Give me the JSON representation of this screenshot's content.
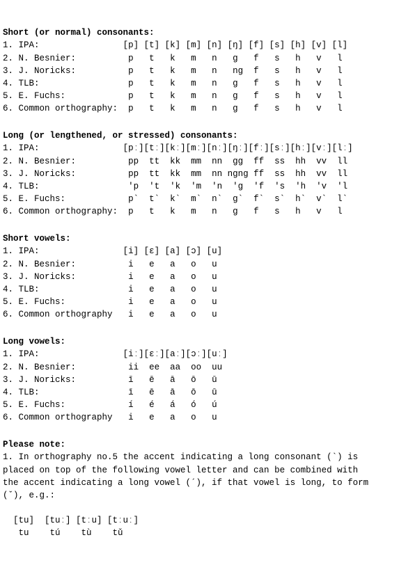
{
  "sections": {
    "short_consonants": {
      "heading": "Short (or normal) consonants:",
      "rows": [
        {
          "num": "1.",
          "label": "IPA:",
          "cells": "[p] [t] [k] [m] [n] [ŋ] [f] [s] [h] [v] [l]"
        },
        {
          "num": "2.",
          "label": "N. Besnier:",
          "cells": " p   t   k   m   n   g   f   s   h   v   l "
        },
        {
          "num": "3.",
          "label": "J. Noricks:",
          "cells": " p   t   k   m   n   ng  f   s   h   v   l "
        },
        {
          "num": "4.",
          "label": "TLB:",
          "cells": " p   t   k   m   n   g   f   s   h   v   l "
        },
        {
          "num": "5.",
          "label": "E. Fuchs:",
          "cells": " p   t   k   m   n   g   f   s   h   v   l "
        },
        {
          "num": "6.",
          "label": "Common orthography:",
          "cells": " p   t   k   m   n   g   f   s   h   v   l "
        }
      ]
    },
    "long_consonants": {
      "heading": "Long (or lengthened, or stressed) consonants:",
      "rows": [
        {
          "num": "1.",
          "label": "IPA:",
          "cells": "[pː][tː][kː][mː][nː][ŋː][fː][sː][hː][vː][lː]"
        },
        {
          "num": "2.",
          "label": "N. Besnier:",
          "cells": " pp  tt  kk  mm  nn  gg  ff  ss  hh  vv  ll "
        },
        {
          "num": "3.",
          "label": "J. Noricks:",
          "cells": " pp  tt  kk  mm  nn ngng ff  ss  hh  vv  ll "
        },
        {
          "num": "4.",
          "label": "TLB:",
          "cells": " 'p  't  'k  'm  'n  'g  'f  's  'h  'v  'l "
        },
        {
          "num": "5.",
          "label": "E. Fuchs:",
          "cells": " p`  t`  k`  m`  n`  g`  f`  s`  h`  v`  l` "
        },
        {
          "num": "6.",
          "label": "Common orthography:",
          "cells": " p   t   k   m   n   g   f   s   h   v   l "
        }
      ]
    },
    "short_vowels": {
      "heading": "Short vowels:",
      "rows": [
        {
          "num": "1.",
          "label": "IPA:",
          "cells": "[i] [ɛ] [a] [ɔ] [u]"
        },
        {
          "num": "2.",
          "label": "N. Besnier:",
          "cells": " i   e   a   o   u "
        },
        {
          "num": "3.",
          "label": "J. Noricks:",
          "cells": " i   e   a   o   u "
        },
        {
          "num": "4.",
          "label": "TLB:",
          "cells": " i   e   a   o   u "
        },
        {
          "num": "5.",
          "label": "E. Fuchs:",
          "cells": " i   e   a   o   u "
        },
        {
          "num": "6.",
          "label": "Common orthography",
          "cells": " i   e   a   o   u "
        }
      ]
    },
    "long_vowels": {
      "heading": "Long vowels:",
      "rows": [
        {
          "num": "1.",
          "label": "IPA:",
          "cells": "[iː][ɛː][aː][ɔː][uː]"
        },
        {
          "num": "2.",
          "label": "N. Besnier:",
          "cells": " ii  ee  aa  oo  uu "
        },
        {
          "num": "3.",
          "label": "J. Noricks:",
          "cells": " ī   ē   ā   ō   ū  "
        },
        {
          "num": "4.",
          "label": "TLB:",
          "cells": " ī   ē   ā   ō   ū  "
        },
        {
          "num": "5.",
          "label": "E. Fuchs:",
          "cells": " í   é   á   ó   ú  "
        },
        {
          "num": "6.",
          "label": "Common orthography",
          "cells": " i   e   a   o   u  "
        }
      ]
    },
    "note": {
      "heading": "Please note:",
      "line1": "1. In orthography no.5 the accent indicating a long consonant (`) is",
      "line2": "placed on top of the following vowel letter and can be combined with",
      "line3": "the accent indicating a long vowel (´), if that vowel is long, to form",
      "line4": "(ˇ), e.g.:",
      "ex_ipa": "  [tu]  [tuː] [tːu] [tːuː]",
      "ex_orth": "   tu    tú    tù    tǔ"
    }
  }
}
